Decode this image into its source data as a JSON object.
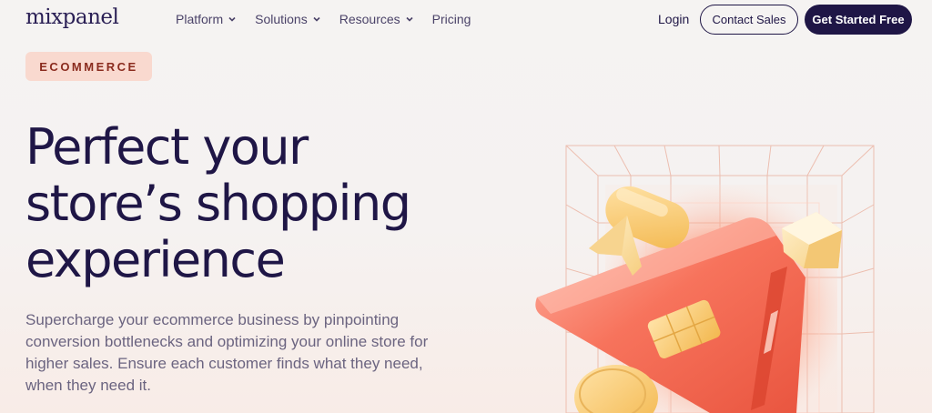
{
  "brand": {
    "logo": "mixpanel"
  },
  "nav": {
    "items": [
      {
        "label": "Platform",
        "dropdown": true
      },
      {
        "label": "Solutions",
        "dropdown": true
      },
      {
        "label": "Resources",
        "dropdown": true
      },
      {
        "label": "Pricing",
        "dropdown": false
      }
    ],
    "login": "Login",
    "contact_sales": "Contact Sales",
    "get_started": "Get Started Free"
  },
  "hero": {
    "tag": "ECOMMERCE",
    "headline": [
      "Perfect your",
      "store’s shopping",
      "experience"
    ],
    "description": "Supercharge your ecommerce business by pinpointing conversion bottlenecks and optimizing your online store for higher sales. Ensure each customer finds what they need, when they need it."
  },
  "colors": {
    "primary": "#1f1646",
    "tag_bg": "#f9d9cf",
    "accent_coral": "#f26a52",
    "accent_gold": "#f5c66a"
  },
  "icons": [
    "chevron-down-icon",
    "shopping-illustration"
  ]
}
